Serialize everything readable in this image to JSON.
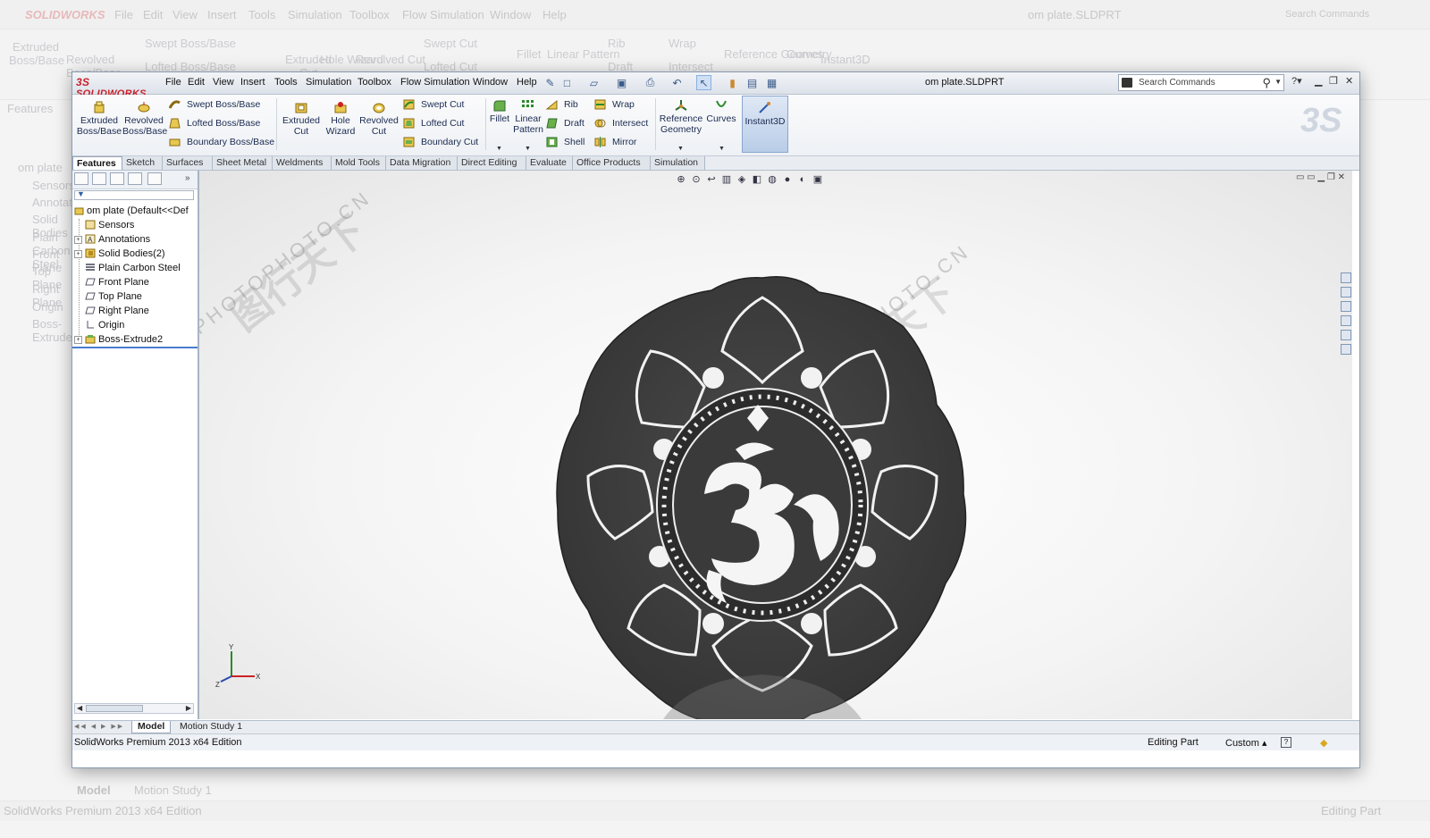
{
  "background": {
    "menu": [
      "File",
      "Edit",
      "View",
      "Insert",
      "Tools",
      "Simulation",
      "Toolbox",
      "Flow Simulation",
      "Window",
      "Help"
    ],
    "title": "om plate.SLDPRT",
    "search_placeholder": "Search Commands",
    "ribbon": [
      "Extruded Boss/Base",
      "Revolved Boss/Base",
      "Swept Boss/Base",
      "Lofted Boss/Base",
      "Extruded Cut",
      "Hole Wizard",
      "Revolved Cut",
      "Swept Cut",
      "Lofted Cut",
      "Fillet",
      "Linear Pattern",
      "Rib",
      "Draft",
      "Wrap",
      "Intersect",
      "Reference Geometry",
      "Curves",
      "Instant3D"
    ],
    "features_tab": "Features",
    "tree": [
      "om plate",
      "Sensors",
      "Annotations",
      "Solid Bodies",
      "Plain Carbon Steel",
      "Front Plane",
      "Top Plane",
      "Right Plane",
      "Origin",
      "Boss-Extrude2"
    ],
    "bottom_tabs": [
      "Model",
      "Motion Study 1"
    ],
    "status_left": "SolidWorks Premium 2013 x64 Edition",
    "status_right": "Editing Part"
  },
  "app": {
    "logo": "SOLIDWORKS",
    "doc_title": "om plate.SLDPRT",
    "menu": [
      "File",
      "Edit",
      "View",
      "Insert",
      "Tools",
      "Simulation",
      "Toolbox",
      "Flow Simulation",
      "Window",
      "Help"
    ],
    "search_placeholder": "Search Commands"
  },
  "ribbon": {
    "extruded_boss": "Extruded Boss/Base",
    "revolved_boss": "Revolved Boss/Base",
    "swept_boss": "Swept Boss/Base",
    "lofted_boss": "Lofted Boss/Base",
    "boundary_boss": "Boundary Boss/Base",
    "extruded_cut": "Extruded Cut",
    "hole_wizard": "Hole Wizard",
    "revolved_cut": "Revolved Cut",
    "swept_cut": "Swept Cut",
    "lofted_cut": "Lofted Cut",
    "boundary_cut": "Boundary Cut",
    "fillet": "Fillet",
    "linear_pattern": "Linear Pattern",
    "rib": "Rib",
    "draft": "Draft",
    "shell": "Shell",
    "wrap": "Wrap",
    "intersect": "Intersect",
    "mirror": "Mirror",
    "reference_geometry": "Reference Geometry",
    "curves": "Curves",
    "instant3d": "Instant3D"
  },
  "tabs": [
    "Features",
    "Sketch",
    "Surfaces",
    "Sheet Metal",
    "Weldments",
    "Mold Tools",
    "Data Migration",
    "Direct Editing",
    "Evaluate",
    "Office Products",
    "Simulation"
  ],
  "feature_tree": {
    "root": "om plate  (Default<<Def",
    "items": [
      "Sensors",
      "Annotations",
      "Solid Bodies(2)",
      "Plain Carbon Steel",
      "Front Plane",
      "Top Plane",
      "Right Plane",
      "Origin",
      "Boss-Extrude2"
    ]
  },
  "triad": {
    "x": "X",
    "y": "Y",
    "z": "Z"
  },
  "watermark": {
    "text": "PHOTOPHOTO.CN"
  },
  "bottom_tabs": [
    "Model",
    "Motion Study 1"
  ],
  "status": {
    "edition": "SolidWorks Premium 2013 x64 Edition",
    "mode": "Editing Part",
    "units": "Custom"
  },
  "colors": {
    "part": "#3f3f3f",
    "accent": "#c8202a",
    "tab_active": "#ffffff"
  }
}
